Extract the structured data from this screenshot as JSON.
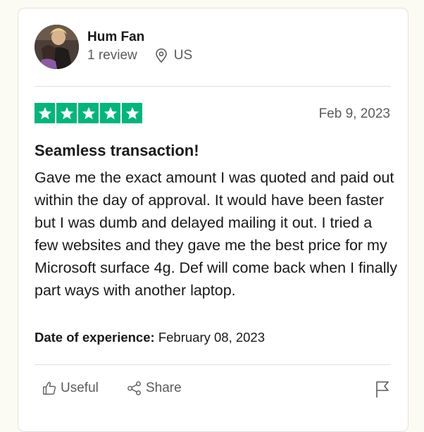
{
  "reviewer": {
    "name": "Hum Fan",
    "review_count": "1 review",
    "country": "US"
  },
  "rating": {
    "stars": 5,
    "max_stars": 5,
    "color": "#00b67a"
  },
  "review": {
    "date": "Feb 9, 2023",
    "title": "Seamless transaction!",
    "body": "Gave me the exact amount I was quoted and paid out within the day of approval. It would have been faster but I was dumb and delayed mailing it out. I tried a few websites and they gave me the best price for my Microsoft surface 4g. Def will come back when I finally part ways with another laptop.",
    "experience_label": "Date of experience:",
    "experience_date": "February 08, 2023"
  },
  "actions": {
    "useful_label": "Useful",
    "useful_icon": "thumbs-up-icon",
    "share_label": "Share",
    "share_icon": "share-icon",
    "report_icon": "flag-icon"
  }
}
